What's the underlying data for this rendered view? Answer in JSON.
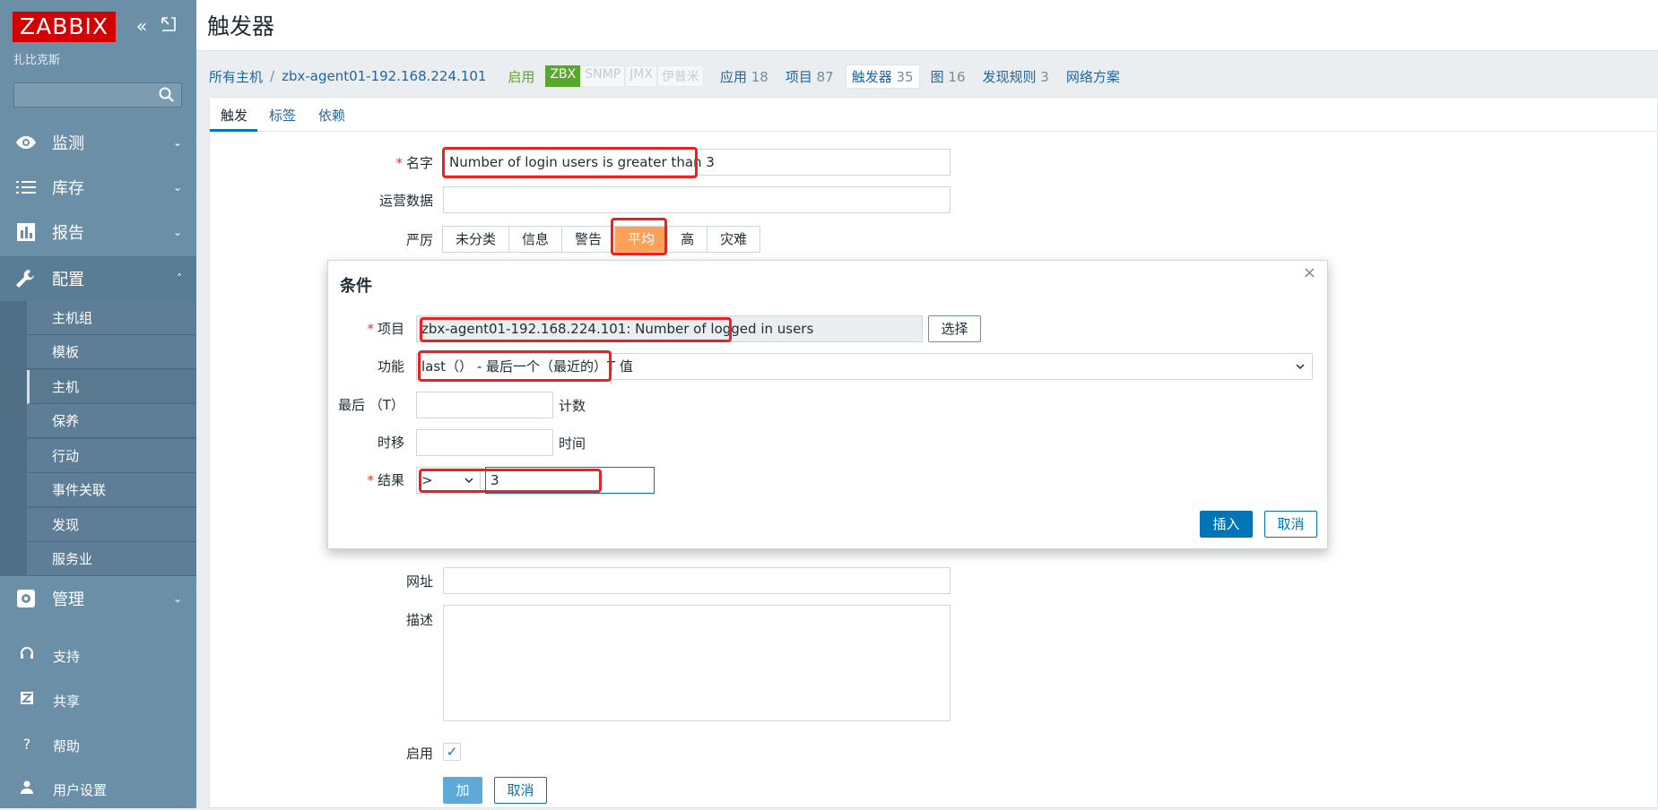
{
  "brand": {
    "logo_text": "ZABBIX",
    "server_name": "扎比克斯"
  },
  "sidebar": {
    "search_placeholder": "",
    "menu": [
      {
        "label": "监测",
        "icon": "eye-icon"
      },
      {
        "label": "库存",
        "icon": "list-icon"
      },
      {
        "label": "报告",
        "icon": "bar-chart-icon"
      },
      {
        "label": "配置",
        "icon": "wrench-icon"
      },
      {
        "label": "管理",
        "icon": "gear-icon"
      }
    ],
    "config_submenu": [
      "主机组",
      "模板",
      "主机",
      "保养",
      "行动",
      "事件关联",
      "发现",
      "服务业"
    ],
    "bottom": [
      {
        "label": "支持",
        "icon": "headset-icon"
      },
      {
        "label": "共享",
        "icon": "share-icon"
      },
      {
        "label": "帮助",
        "icon": "help-icon"
      },
      {
        "label": "用户设置",
        "icon": "user-icon"
      }
    ]
  },
  "header": {
    "title": "触发器"
  },
  "host_nav": {
    "all_hosts": "所有主机",
    "separator": "/",
    "host": "zbx-agent01-192.168.224.101",
    "status": "启用",
    "availability": [
      "ZBX",
      "SNMP",
      "JMX",
      "伊普米"
    ],
    "tabs": [
      {
        "label": "应用",
        "count": "18"
      },
      {
        "label": "项目",
        "count": "87"
      },
      {
        "label": "触发器",
        "count": "35"
      },
      {
        "label": "图",
        "count": "16"
      },
      {
        "label": "发现规则",
        "count": "3"
      },
      {
        "label": "网络方案",
        "count": ""
      }
    ]
  },
  "form": {
    "tabs": [
      "触发",
      "标签",
      "依赖"
    ],
    "name_label": "名字",
    "name_value": "Number of login users is greater than 3",
    "opdata_label": "运营数据",
    "opdata_value": "",
    "severity_label": "严厉",
    "severities": [
      "未分类",
      "信息",
      "警告",
      "平均",
      "高",
      "灾难"
    ],
    "url_label": "网址",
    "url_value": "",
    "description_label": "描述",
    "description_value": "",
    "enabled_label": "启用",
    "enabled_mark": "✓",
    "add_button": "加",
    "cancel_button": "取消"
  },
  "dialog": {
    "title": "条件",
    "close": "×",
    "item_label": "项目",
    "item_value": "zbx-agent01-192.168.224.101: Number of logged in users",
    "select_button": "选择",
    "function_label": "功能",
    "function_value": "last（） - 最后一个（最近的）T 值",
    "last_label": "最后 （T）",
    "last_value": "",
    "last_suffix": "计数",
    "shift_label": "时移",
    "shift_value": "",
    "shift_suffix": "时间",
    "result_label": "结果",
    "result_operator": ">",
    "result_value": "3",
    "insert_button": "插入",
    "cancel_button": "取消"
  },
  "colors": {
    "accent": "#0275b8",
    "sidebar": "#6c8fa8",
    "highlight": "#ef2020",
    "severity_average": "#ffa059",
    "enabled": "#59a72c"
  }
}
